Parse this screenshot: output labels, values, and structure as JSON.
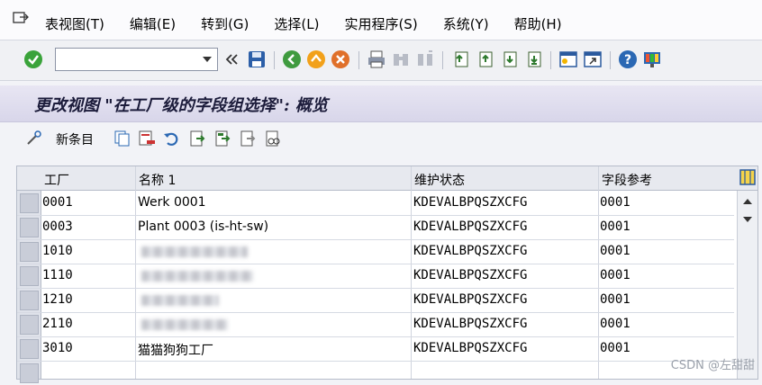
{
  "menu": [
    "表视图(T)",
    "编辑(E)",
    "转到(G)",
    "选择(L)",
    "实用程序(S)",
    "系统(Y)",
    "帮助(H)"
  ],
  "toolbar": {
    "command_value": ""
  },
  "title": "更改视图 \"在工厂级的字段组选择\": 概览",
  "app_toolbar": {
    "new_entry_label": "新条目"
  },
  "table": {
    "headers": {
      "plant": "工厂",
      "name": "名称 1",
      "maint_status": "维护状态",
      "field_ref": "字段参考"
    },
    "rows": [
      {
        "plant": "0001",
        "name": "Werk 0001",
        "status": "KDEVALBPQSZXCFG",
        "ref": "0001"
      },
      {
        "plant": "0003",
        "name": "Plant 0003 (is-ht-sw)",
        "status": "KDEVALBPQSZXCFG",
        "ref": "0001"
      },
      {
        "plant": "1010",
        "name": "",
        "status": "KDEVALBPQSZXCFG",
        "ref": "0001"
      },
      {
        "plant": "1110",
        "name": "",
        "status": "KDEVALBPQSZXCFG",
        "ref": "0001"
      },
      {
        "plant": "1210",
        "name": "",
        "status": "KDEVALBPQSZXCFG",
        "ref": "0001"
      },
      {
        "plant": "2110",
        "name": "",
        "status": "KDEVALBPQSZXCFG",
        "ref": "0001"
      },
      {
        "plant": "3010",
        "name": "猫猫狗狗工厂",
        "status": "KDEVALBPQSZXCFG",
        "ref": "0001"
      }
    ]
  },
  "watermark": "CSDN @左甜甜",
  "colors": {
    "accent": "#1b1b3a",
    "title_bg": "#d8d6ea"
  }
}
